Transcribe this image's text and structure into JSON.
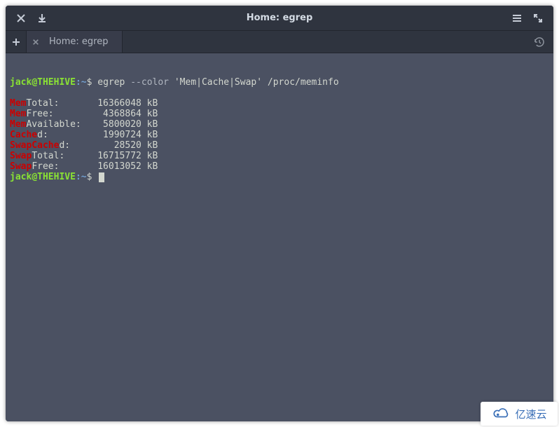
{
  "window": {
    "title": "Home: egrep"
  },
  "tabs": [
    {
      "label": "Home: egrep"
    }
  ],
  "prompt": {
    "user": "jack",
    "host": "THEHIVE",
    "cwd": "~",
    "symbol": "$"
  },
  "command": {
    "cmd": "egrep",
    "option": "--color",
    "pattern": "'Mem|Cache|Swap'",
    "file": "/proc/meminfo"
  },
  "output": [
    {
      "hl": "Mem",
      "rest": "Total:",
      "value": "16366048",
      "unit": "kB"
    },
    {
      "hl": "Mem",
      "rest": "Free:",
      "value": "4368864",
      "unit": "kB"
    },
    {
      "hl": "Mem",
      "rest": "Available:",
      "value": "5800020",
      "unit": "kB"
    },
    {
      "hl": "Cache",
      "rest": "d:",
      "value": "1990724",
      "unit": "kB"
    },
    {
      "hl": "SwapCache",
      "rest": "d:",
      "value": "28520",
      "unit": "kB"
    },
    {
      "hl": "Swap",
      "rest": "Total:",
      "value": "16715772",
      "unit": "kB"
    },
    {
      "hl": "Swap",
      "rest": "Free:",
      "value": "16013052",
      "unit": "kB"
    }
  ],
  "watermark": "亿速云"
}
